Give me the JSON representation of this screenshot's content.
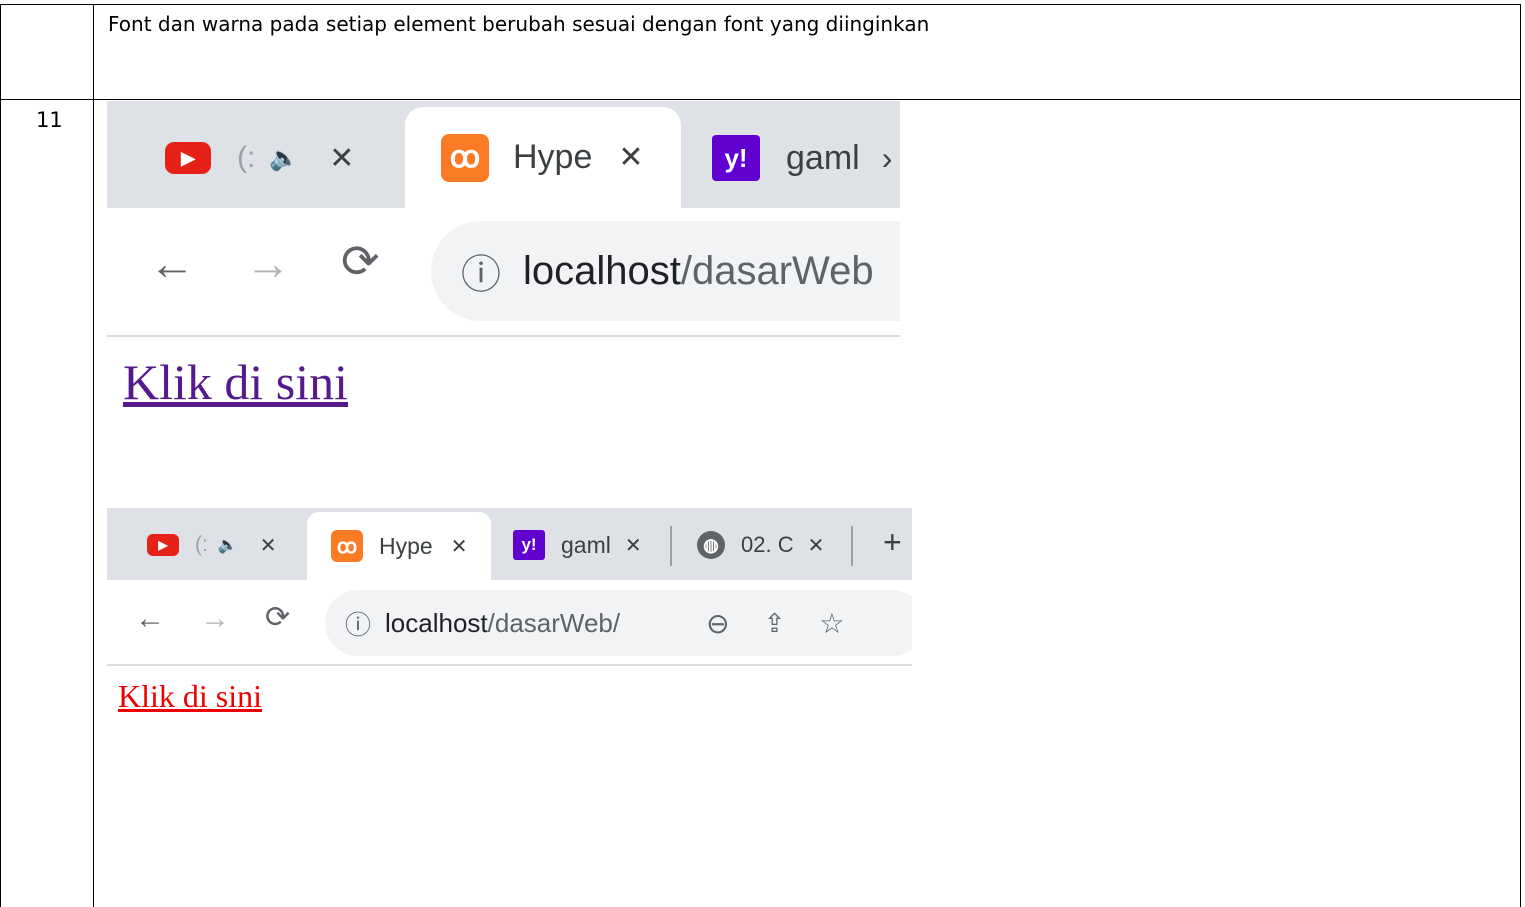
{
  "table": {
    "description": "Font dan warna pada setiap element berubah sesuai dengan font yang diinginkan",
    "row_number": "11"
  },
  "screenshot_before": {
    "tabs": [
      {
        "label": "(:",
        "favicon": "youtube-icon",
        "close": "✕"
      },
      {
        "label": "Hype",
        "favicon": "xampp-icon",
        "close": "✕"
      },
      {
        "label": "gaml",
        "favicon": "yahoo-icon",
        "close": "›"
      }
    ],
    "url_host": "localhost",
    "url_path": "/dasarWeb",
    "link_text": "Klik di sini",
    "link_color": "#551a8b"
  },
  "screenshot_after": {
    "tabs": [
      {
        "label": "(:",
        "favicon": "youtube-icon",
        "close": "✕"
      },
      {
        "label": "Hype",
        "favicon": "xampp-icon",
        "close": "✕"
      },
      {
        "label": "gaml",
        "favicon": "yahoo-icon",
        "close": "✕"
      },
      {
        "label": "02. C",
        "favicon": "globe-icon",
        "close": "✕"
      }
    ],
    "new_tab": "+",
    "url_host": "localhost",
    "url_path": "/dasarWeb/",
    "link_text": "Klik di sini",
    "link_color": "#ee0000"
  },
  "icons": {
    "back": "←",
    "forward": "→",
    "reload": "⟳",
    "info": "ⓘ",
    "speaker": "🔈",
    "zoom": "⊖",
    "share": "⇪",
    "star": "☆",
    "youtube": "▶",
    "xampp": "ꝏ",
    "yahoo": "y!",
    "globe": "◍"
  }
}
